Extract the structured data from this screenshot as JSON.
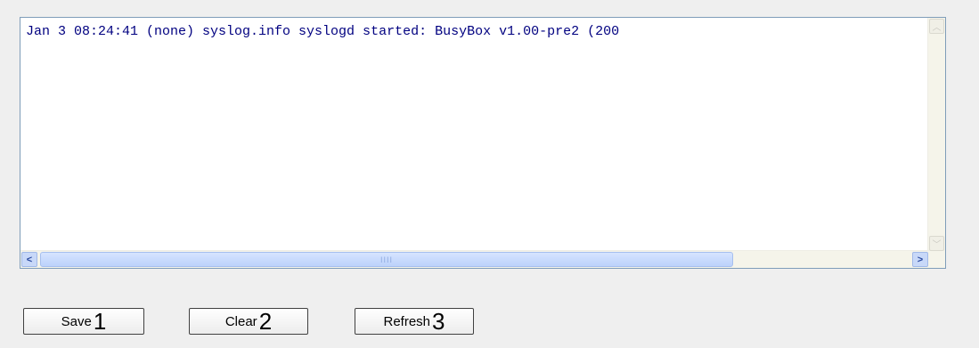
{
  "log": {
    "text": "Jan  3 08:24:41 (none) syslog.info syslogd started: BusyBox v1.00-pre2 (200"
  },
  "scrollbars": {
    "vertical_up_glyph": "︿",
    "vertical_down_glyph": "﹀",
    "horizontal_left_glyph": "<",
    "horizontal_right_glyph": ">",
    "thumb_grip": "IIII"
  },
  "buttons": [
    {
      "label": "Save",
      "number": "1"
    },
    {
      "label": "Clear",
      "number": "2"
    },
    {
      "label": "Refresh",
      "number": "3"
    }
  ]
}
